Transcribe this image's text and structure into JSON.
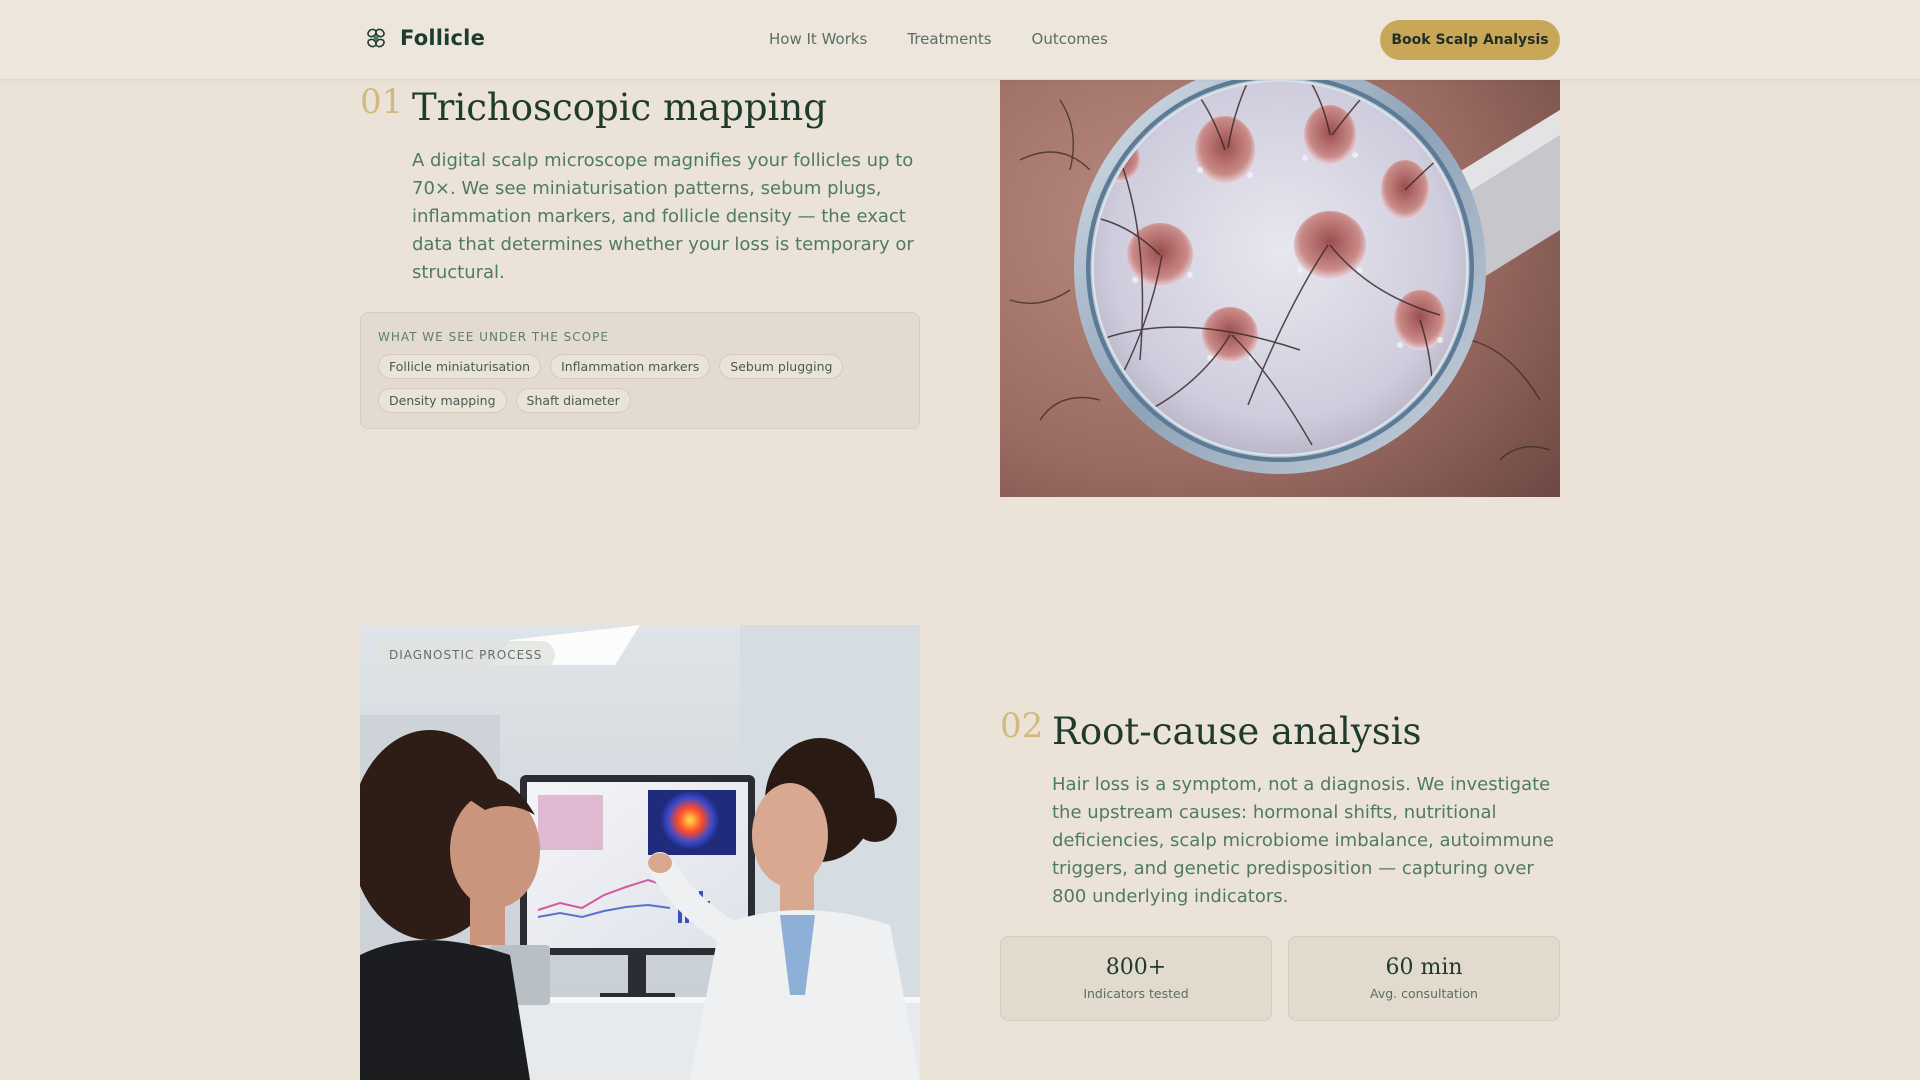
{
  "header": {
    "brand": "Follicle",
    "nav": [
      "How It Works",
      "Treatments",
      "Outcomes"
    ],
    "cta": "Book Scalp Analysis"
  },
  "section1": {
    "number": "01",
    "title": "Trichoscopic mapping",
    "lines": [
      "A digital scalp microscope magnifies your follicles up to",
      "70×. We see miniaturisation patterns, sebum plugs,",
      "inflammation markers, and follicle density — the exact",
      "data that determines whether your loss is temporary or",
      "structural."
    ],
    "scope_label": "WHAT WE SEE UNDER THE SCOPE",
    "tags": [
      "Follicle miniaturisation",
      "Inflammation markers",
      "Sebum plugging",
      "Density mapping",
      "Shaft diameter"
    ]
  },
  "section2": {
    "badge": "DIAGNOSTIC PROCESS",
    "number": "02",
    "title": "Root-cause analysis",
    "lines": [
      "Hair loss is a symptom, not a diagnosis. We investigate",
      "the upstream causes: hormonal shifts, nutritional",
      "deficiencies, scalp microbiome imbalance, autoimmune",
      "triggers, and genetic predisposition — capturing over",
      "800 underlying indicators."
    ],
    "stats": [
      {
        "value": "800+",
        "label": "Indicators tested"
      },
      {
        "value": "60 min",
        "label": "Avg. consultation"
      }
    ]
  },
  "colors": {
    "background": "#ebe3d8",
    "accent": "#c9a758",
    "heading": "#1f3b2d",
    "body_text": "#4f7a65"
  },
  "icons": {
    "brand": "follicle-logo-icon"
  }
}
